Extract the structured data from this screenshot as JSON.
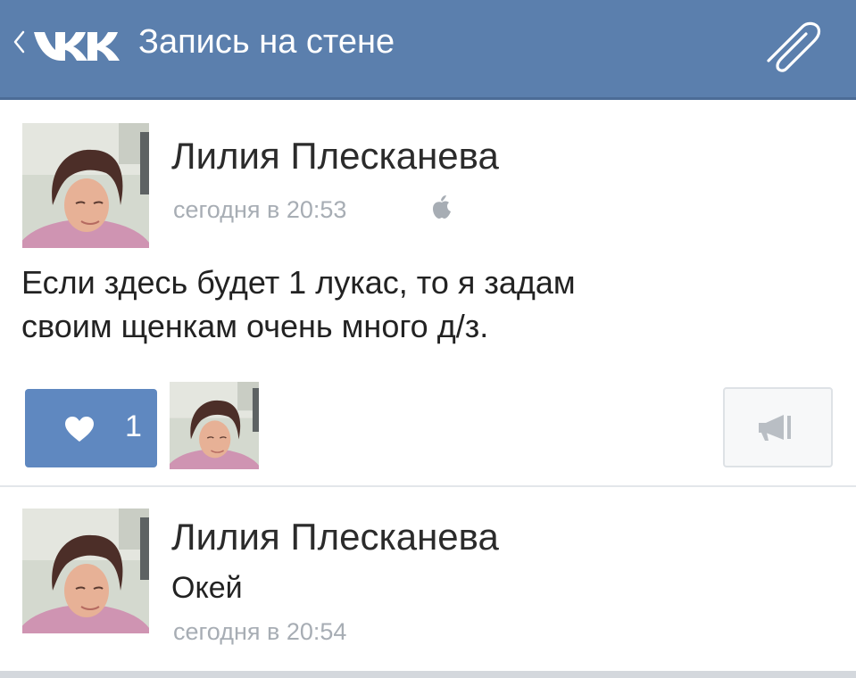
{
  "header": {
    "back_icon": "chevron-left-icon",
    "logo_icon": "vk-logo-icon",
    "title": "Запись на стене",
    "attach_icon": "paperclip-icon",
    "background_color": "#5b7fad"
  },
  "post": {
    "author": "Лилия Плесканева",
    "timestamp": "сегодня в 20:53",
    "platform_icon": "apple-icon",
    "text_line1": "Если здесь будет 1 лукас, то я задам",
    "text_line2": "своим щенкам очень много д/з."
  },
  "actions": {
    "like_icon": "heart-icon",
    "like_count": "1",
    "like_button_color": "#5f88c0",
    "share_icon": "megaphone-icon"
  },
  "comment": {
    "author": "Лилия Плесканева",
    "text": "Окей",
    "timestamp": "сегодня в 20:54"
  }
}
